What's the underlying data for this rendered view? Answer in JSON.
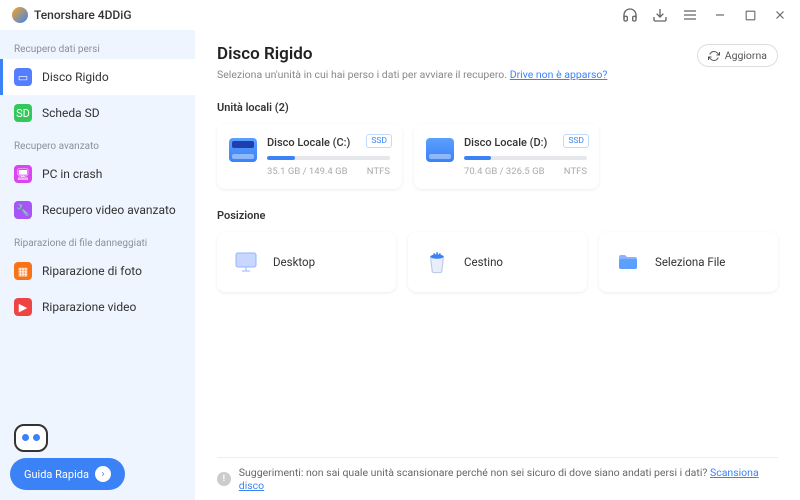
{
  "app": {
    "name": "Tenorshare 4DDiG"
  },
  "sidebar": {
    "group1_title": "Recupero dati persi",
    "group1": [
      {
        "label": "Disco Rigido",
        "icon_bg": "#547dff"
      },
      {
        "label": "Scheda SD",
        "icon_bg": "#34c759"
      }
    ],
    "group2_title": "Recupero avanzato",
    "group2": [
      {
        "label": "PC in crash",
        "icon_bg": "#d946ef"
      },
      {
        "label": "Recupero video avanzato",
        "icon_bg": "#a855f7"
      }
    ],
    "group3_title": "Riparazione di file danneggiati",
    "group3": [
      {
        "label": "Riparazione di foto",
        "icon_bg": "#f97316"
      },
      {
        "label": "Riparazione video",
        "icon_bg": "#ef4444"
      }
    ],
    "guide_label": "Guida Rapida"
  },
  "header": {
    "title": "Disco Rigido",
    "subtitle_pre": "Seleziona un'unità in cui hai perso i dati per avviare il recupero. ",
    "subtitle_link": "Drive non è apparso?",
    "refresh": "Aggiorna"
  },
  "drives_section": {
    "title": "Unità locali (2)",
    "items": [
      {
        "name": "Disco Locale (C:)",
        "badge": "SSD",
        "size": "35.1 GB / 149.4 GB",
        "fs": "NTFS",
        "pct": 23
      },
      {
        "name": "Disco Locale (D:)",
        "badge": "SSD",
        "size": "70.4 GB / 326.5 GB",
        "fs": "NTFS",
        "pct": 22
      }
    ]
  },
  "locations_section": {
    "title": "Posizione",
    "items": [
      {
        "label": "Desktop"
      },
      {
        "label": "Cestino"
      },
      {
        "label": "Seleziona File"
      }
    ]
  },
  "tip": {
    "pre": "Suggerimenti: non sai quale unità scansionare perché non sei sicuro di dove siano andati persi i dati? ",
    "link": "Scansiona disco"
  }
}
